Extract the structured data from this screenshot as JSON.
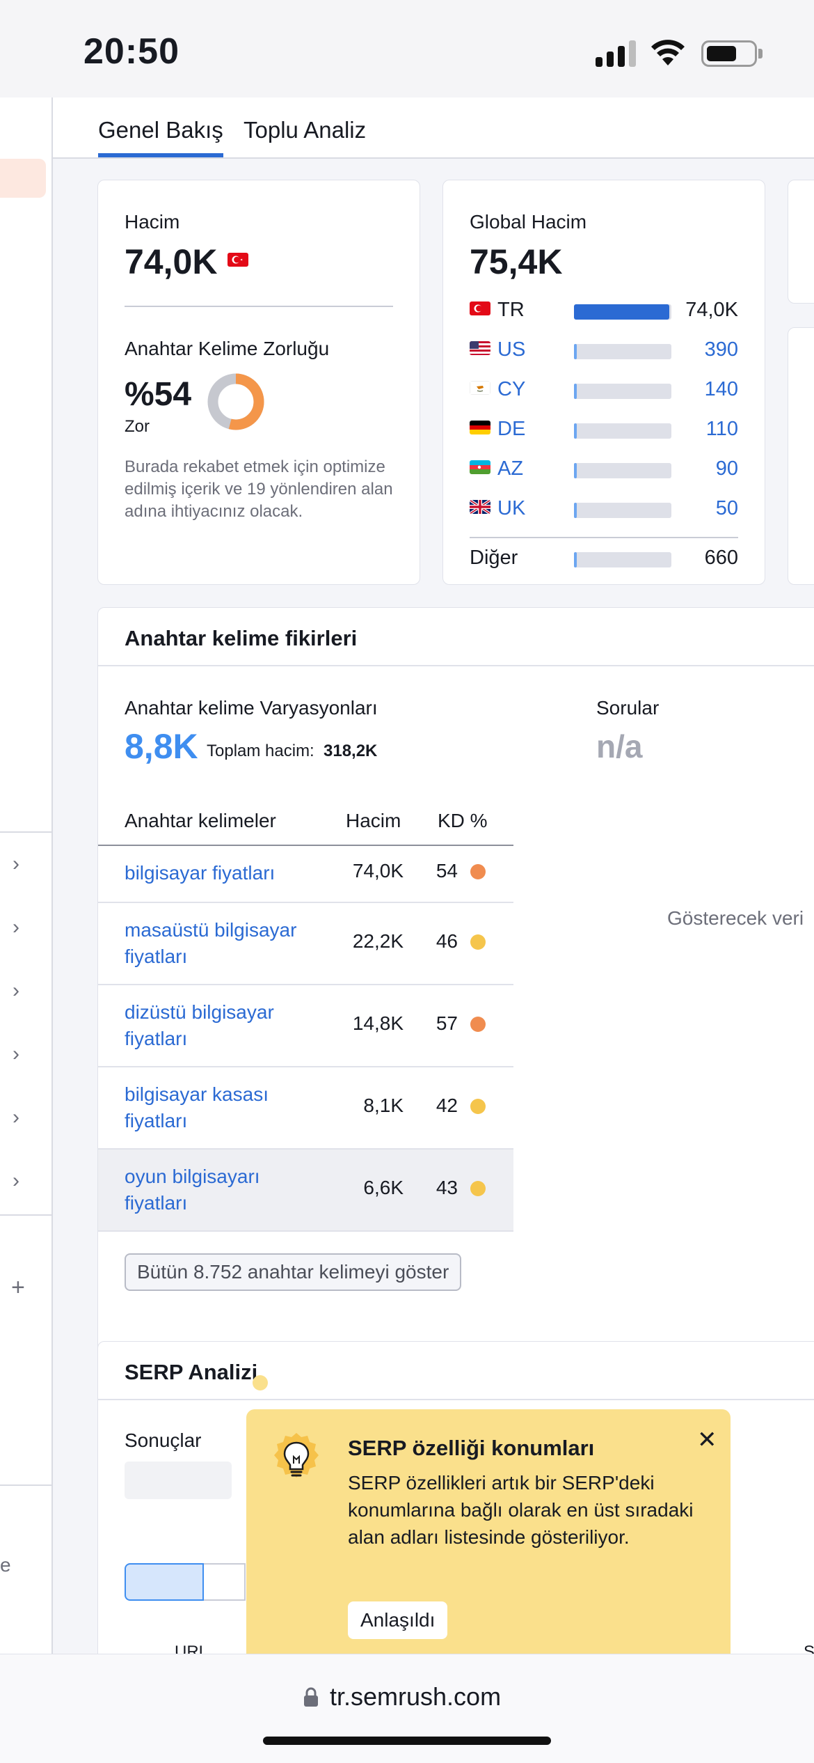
{
  "status_bar": {
    "time": "20:50"
  },
  "tabs": [
    {
      "label": "Genel Bakış"
    },
    {
      "label": "Toplu Analiz"
    }
  ],
  "volume_card": {
    "label": "Hacim",
    "value": "74,0K",
    "kd_label": "Anahtar Kelime Zorluğu",
    "kd_value": "%54",
    "kd_level": "Zor",
    "kd_percent": 54,
    "description": "Burada rekabet etmek için optimize edilmiş içerik ve 19 yönlendiren alan adına ihtiyacınız olacak.",
    "colors": {
      "kd_fill": "#f4964a",
      "kd_track": "#c6c8cf"
    }
  },
  "global_card": {
    "label": "Global Hacim",
    "value": "75,4K",
    "countries": [
      {
        "code": "TR",
        "value": "74,0K",
        "share": 0.98,
        "flag": "tr-flag-icon",
        "link": false
      },
      {
        "code": "US",
        "value": "390",
        "share": 0.02,
        "flag": "us-flag-icon",
        "link": true
      },
      {
        "code": "CY",
        "value": "140",
        "share": 0.02,
        "flag": "cy-flag-icon",
        "link": true
      },
      {
        "code": "DE",
        "value": "110",
        "share": 0.02,
        "flag": "de-flag-icon",
        "link": true
      },
      {
        "code": "AZ",
        "value": "90",
        "share": 0.02,
        "flag": "az-flag-icon",
        "link": true
      },
      {
        "code": "UK",
        "value": "50",
        "share": 0.02,
        "flag": "uk-flag-icon",
        "link": true
      }
    ],
    "other": {
      "label": "Diğer",
      "value": "660",
      "share": 0.02
    }
  },
  "ideas": {
    "title": "Anahtar kelime fikirleri",
    "variations_label": "Anahtar kelime Varyasyonları",
    "variations_value": "8,8K",
    "total_label": "Toplam hacim:",
    "total_value": "318,2K",
    "questions_label": "Sorular",
    "questions_value": "n/a",
    "empty_text": "Gösterecek veri",
    "columns": {
      "keyword": "Anahtar kelimeler",
      "volume": "Hacim",
      "kd": "KD %"
    },
    "rows": [
      {
        "keyword": "bilgisayar fiyatları",
        "volume": "74,0K",
        "kd": "54",
        "kd_color": "#f08c4f"
      },
      {
        "keyword": "masaüstü bilgisayar fiyatları",
        "volume": "22,2K",
        "kd": "46",
        "kd_color": "#f5c54c"
      },
      {
        "keyword": "dizüstü bilgisayar fiyatları",
        "volume": "14,8K",
        "kd": "57",
        "kd_color": "#f08c4f"
      },
      {
        "keyword": "bilgisayar kasası fiyatları",
        "volume": "8,1K",
        "kd": "42",
        "kd_color": "#f5c54c"
      },
      {
        "keyword": "oyun bilgisayarı fiyatları",
        "volume": "6,6K",
        "kd": "43",
        "kd_color": "#f5c54c"
      }
    ],
    "show_all": "Bütün 8.752 anahtar kelimeyi göster"
  },
  "serp": {
    "title": "SERP Analizi",
    "results_label": "Sonuçlar",
    "url_col": "URL",
    "right_col": "S"
  },
  "tooltip": {
    "title": "SERP özelliği konumları",
    "text": "SERP özellikleri artık bir SERP'deki konumlarına bağlı olarak en üst sıradaki alan adları listesinde gösteriliyor.",
    "button": "Anlaşıldı",
    "close": "✕"
  },
  "rail": {
    "bottom_letter": "e",
    "plus": "+"
  },
  "url_bar": {
    "url": "tr.semrush.com"
  }
}
